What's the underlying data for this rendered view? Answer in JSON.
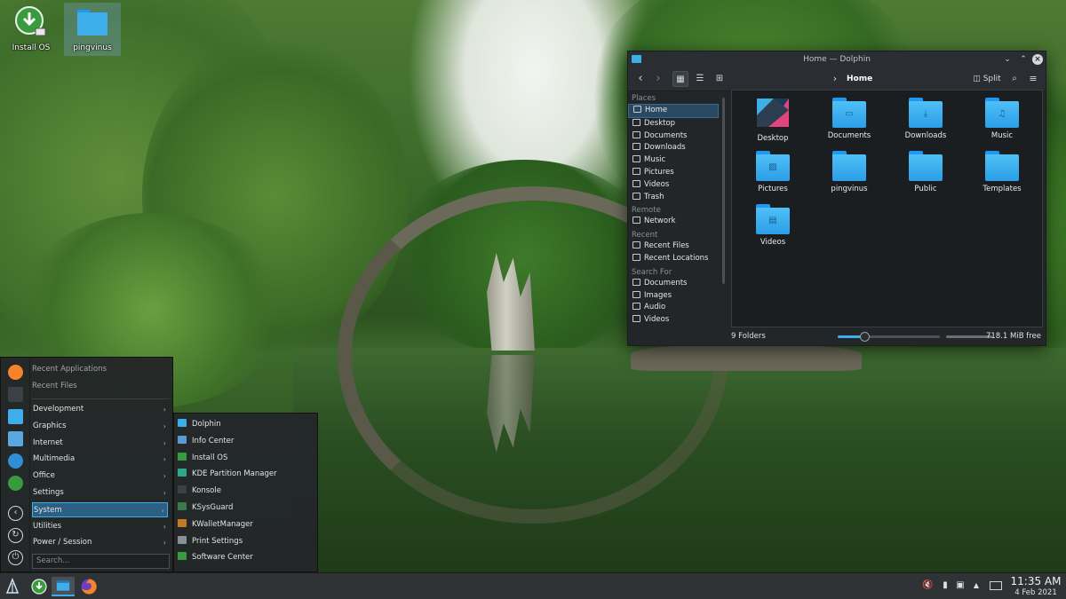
{
  "desktop": {
    "icons": [
      {
        "label": "Install OS",
        "icon": "install-download-icon"
      },
      {
        "label": "pingvinus",
        "icon": "folder-icon"
      }
    ]
  },
  "dolphin": {
    "window_title": "Home — Dolphin",
    "toolbar": {
      "back": "back-arrow-icon",
      "forward": "forward-arrow-icon",
      "breadcrumb": "Home",
      "split_label": "Split"
    },
    "places": {
      "sections": [
        {
          "title": "Places",
          "items": [
            "Home",
            "Desktop",
            "Documents",
            "Downloads",
            "Music",
            "Pictures",
            "Videos",
            "Trash"
          ]
        },
        {
          "title": "Remote",
          "items": [
            "Network"
          ]
        },
        {
          "title": "Recent",
          "items": [
            "Recent Files",
            "Recent Locations"
          ]
        },
        {
          "title": "Search For",
          "items": [
            "Documents",
            "Images",
            "Audio",
            "Videos"
          ]
        }
      ],
      "selected": "Home"
    },
    "folders": [
      {
        "name": "Desktop",
        "emblem": "desktop"
      },
      {
        "name": "Documents",
        "emblem": "document"
      },
      {
        "name": "Downloads",
        "emblem": "download"
      },
      {
        "name": "Music",
        "emblem": "music"
      },
      {
        "name": "Pictures",
        "emblem": "picture"
      },
      {
        "name": "pingvinus",
        "emblem": ""
      },
      {
        "name": "Public",
        "emblem": ""
      },
      {
        "name": "Templates",
        "emblem": ""
      },
      {
        "name": "Videos",
        "emblem": "video"
      }
    ],
    "status": {
      "count": "9 Folders",
      "free": "718.1 MiB free",
      "zoom": 0.25
    }
  },
  "menu": {
    "headers": [
      "Recent Applications",
      "Recent Files"
    ],
    "categories": [
      "Development",
      "Graphics",
      "Internet",
      "Multimedia",
      "Office",
      "Settings",
      "System",
      "Utilities",
      "Power / Session"
    ],
    "selected_category": "System",
    "search_placeholder": "Search...",
    "favorites": [
      "firefox-icon",
      "konsole-icon",
      "dolphin-icon",
      "network-icon",
      "discover-icon",
      "install-icon"
    ],
    "session": [
      "back-icon",
      "restart-icon",
      "power-icon"
    ],
    "system_apps": [
      "Dolphin",
      "Info Center",
      "Install OS",
      "KDE Partition Manager",
      "Konsole",
      "KSysGuard",
      "KWalletManager",
      "Print Settings",
      "Software Center"
    ]
  },
  "taskbar": {
    "launcher": "kde-launcher-icon",
    "tasks": [
      "install-icon",
      "dolphin-icon",
      "firefox-icon"
    ],
    "tray": [
      "volume-muted-icon",
      "usb-icon",
      "network-icon",
      "expand-icon"
    ],
    "time": "11:35 AM",
    "date": "4 Feb 2021"
  },
  "colors": {
    "accent": "#3daee9",
    "folder": "#2b9fe8",
    "panel": "#2f3336",
    "window": "#232629"
  }
}
